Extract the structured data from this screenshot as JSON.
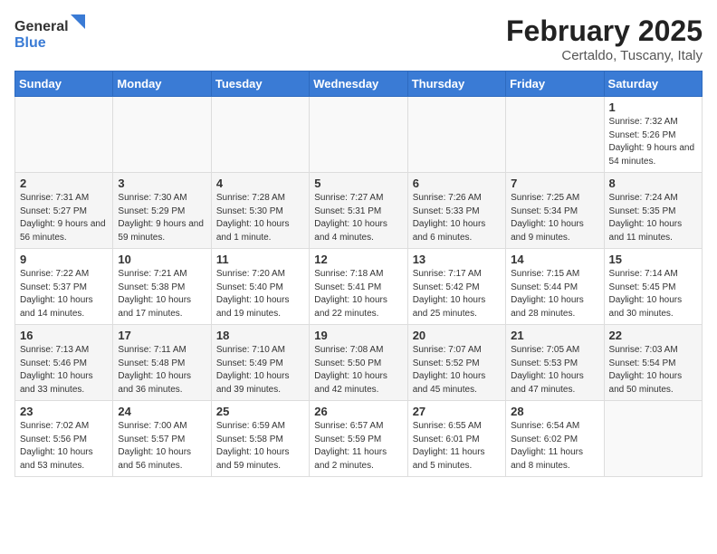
{
  "header": {
    "logo_general": "General",
    "logo_blue": "Blue",
    "month_year": "February 2025",
    "location": "Certaldo, Tuscany, Italy"
  },
  "weekdays": [
    "Sunday",
    "Monday",
    "Tuesday",
    "Wednesday",
    "Thursday",
    "Friday",
    "Saturday"
  ],
  "weeks": [
    [
      {
        "day": "",
        "info": ""
      },
      {
        "day": "",
        "info": ""
      },
      {
        "day": "",
        "info": ""
      },
      {
        "day": "",
        "info": ""
      },
      {
        "day": "",
        "info": ""
      },
      {
        "day": "",
        "info": ""
      },
      {
        "day": "1",
        "info": "Sunrise: 7:32 AM\nSunset: 5:26 PM\nDaylight: 9 hours and 54 minutes."
      }
    ],
    [
      {
        "day": "2",
        "info": "Sunrise: 7:31 AM\nSunset: 5:27 PM\nDaylight: 9 hours and 56 minutes."
      },
      {
        "day": "3",
        "info": "Sunrise: 7:30 AM\nSunset: 5:29 PM\nDaylight: 9 hours and 59 minutes."
      },
      {
        "day": "4",
        "info": "Sunrise: 7:28 AM\nSunset: 5:30 PM\nDaylight: 10 hours and 1 minute."
      },
      {
        "day": "5",
        "info": "Sunrise: 7:27 AM\nSunset: 5:31 PM\nDaylight: 10 hours and 4 minutes."
      },
      {
        "day": "6",
        "info": "Sunrise: 7:26 AM\nSunset: 5:33 PM\nDaylight: 10 hours and 6 minutes."
      },
      {
        "day": "7",
        "info": "Sunrise: 7:25 AM\nSunset: 5:34 PM\nDaylight: 10 hours and 9 minutes."
      },
      {
        "day": "8",
        "info": "Sunrise: 7:24 AM\nSunset: 5:35 PM\nDaylight: 10 hours and 11 minutes."
      }
    ],
    [
      {
        "day": "9",
        "info": "Sunrise: 7:22 AM\nSunset: 5:37 PM\nDaylight: 10 hours and 14 minutes."
      },
      {
        "day": "10",
        "info": "Sunrise: 7:21 AM\nSunset: 5:38 PM\nDaylight: 10 hours and 17 minutes."
      },
      {
        "day": "11",
        "info": "Sunrise: 7:20 AM\nSunset: 5:40 PM\nDaylight: 10 hours and 19 minutes."
      },
      {
        "day": "12",
        "info": "Sunrise: 7:18 AM\nSunset: 5:41 PM\nDaylight: 10 hours and 22 minutes."
      },
      {
        "day": "13",
        "info": "Sunrise: 7:17 AM\nSunset: 5:42 PM\nDaylight: 10 hours and 25 minutes."
      },
      {
        "day": "14",
        "info": "Sunrise: 7:15 AM\nSunset: 5:44 PM\nDaylight: 10 hours and 28 minutes."
      },
      {
        "day": "15",
        "info": "Sunrise: 7:14 AM\nSunset: 5:45 PM\nDaylight: 10 hours and 30 minutes."
      }
    ],
    [
      {
        "day": "16",
        "info": "Sunrise: 7:13 AM\nSunset: 5:46 PM\nDaylight: 10 hours and 33 minutes."
      },
      {
        "day": "17",
        "info": "Sunrise: 7:11 AM\nSunset: 5:48 PM\nDaylight: 10 hours and 36 minutes."
      },
      {
        "day": "18",
        "info": "Sunrise: 7:10 AM\nSunset: 5:49 PM\nDaylight: 10 hours and 39 minutes."
      },
      {
        "day": "19",
        "info": "Sunrise: 7:08 AM\nSunset: 5:50 PM\nDaylight: 10 hours and 42 minutes."
      },
      {
        "day": "20",
        "info": "Sunrise: 7:07 AM\nSunset: 5:52 PM\nDaylight: 10 hours and 45 minutes."
      },
      {
        "day": "21",
        "info": "Sunrise: 7:05 AM\nSunset: 5:53 PM\nDaylight: 10 hours and 47 minutes."
      },
      {
        "day": "22",
        "info": "Sunrise: 7:03 AM\nSunset: 5:54 PM\nDaylight: 10 hours and 50 minutes."
      }
    ],
    [
      {
        "day": "23",
        "info": "Sunrise: 7:02 AM\nSunset: 5:56 PM\nDaylight: 10 hours and 53 minutes."
      },
      {
        "day": "24",
        "info": "Sunrise: 7:00 AM\nSunset: 5:57 PM\nDaylight: 10 hours and 56 minutes."
      },
      {
        "day": "25",
        "info": "Sunrise: 6:59 AM\nSunset: 5:58 PM\nDaylight: 10 hours and 59 minutes."
      },
      {
        "day": "26",
        "info": "Sunrise: 6:57 AM\nSunset: 5:59 PM\nDaylight: 11 hours and 2 minutes."
      },
      {
        "day": "27",
        "info": "Sunrise: 6:55 AM\nSunset: 6:01 PM\nDaylight: 11 hours and 5 minutes."
      },
      {
        "day": "28",
        "info": "Sunrise: 6:54 AM\nSunset: 6:02 PM\nDaylight: 11 hours and 8 minutes."
      },
      {
        "day": "",
        "info": ""
      }
    ]
  ]
}
